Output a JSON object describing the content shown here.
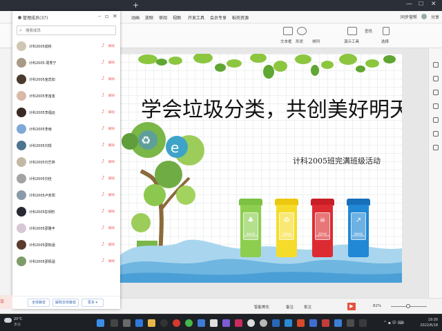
{
  "window": {
    "new_tab": "+",
    "min": "—",
    "max": "☐",
    "close": "✕"
  },
  "menubar": {
    "items": [
      "动画",
      "放映",
      "审阅",
      "视图",
      "开发工具",
      "会员专享",
      "稻壳资源"
    ],
    "share_label": "同步营帮",
    "user_label": "分享"
  },
  "ribbon": {
    "items": [
      "文本框",
      "形状",
      "排列",
      "演示工具",
      "查找",
      "选择"
    ]
  },
  "slide": {
    "title": "学会垃圾分类，共创美好明天",
    "subtitle": "计科2005班完满班级活动",
    "bins": [
      {
        "color": "#7cc142",
        "symbol": "♣",
        "label": "厨余垃圾",
        "label_en": "KITCHEN WASTE"
      },
      {
        "color": "#f2d417",
        "symbol": "♻",
        "label": "可回收物",
        "label_en": "RECYCLABLE"
      },
      {
        "color": "#d9232a",
        "symbol": "☠",
        "label": "有害垃圾",
        "label_en": "HARMFUL WASTE"
      },
      {
        "color": "#1c7fd0",
        "symbol": "↗",
        "label": "其他垃圾",
        "label_en": "OTHER WASTE"
      }
    ]
  },
  "statusbar": {
    "notes": "备注",
    "comments": "批注",
    "beautify": "智能美化",
    "zoom": "82%"
  },
  "member_panel": {
    "title": "管理成员(37)",
    "search_placeholder": "搜索成员",
    "members": [
      {
        "name": "计科2005成彬",
        "action": "解除"
      },
      {
        "name": "计科2005-周秀宁",
        "action": "解除"
      },
      {
        "name": "计科2005金蕊如",
        "action": "解除"
      },
      {
        "name": "计科2005李宙宙",
        "action": "解除"
      },
      {
        "name": "计科2005李福远",
        "action": "解除"
      },
      {
        "name": "计科2005李雨",
        "action": "解除"
      },
      {
        "name": "计科2005刘璟",
        "action": "解除"
      },
      {
        "name": "计科2005刘艺婷",
        "action": "解除"
      },
      {
        "name": "计科2005刘佳",
        "action": "解除"
      },
      {
        "name": "计科2005卢俞阳",
        "action": "解除"
      },
      {
        "name": "计科2005彭玥形",
        "action": "解除"
      },
      {
        "name": "计科2005邵雅丰",
        "action": "解除"
      },
      {
        "name": "计科2005邵知涵",
        "action": "解除"
      },
      {
        "name": "计科2005邵佩涵",
        "action": "解除"
      }
    ],
    "footer": {
      "mute_all": "全体静音",
      "unmute_all": "解除全体静音",
      "more": "更多 ▾"
    },
    "left_edge_text": "议"
  },
  "taskbar": {
    "temp": "20°C",
    "weather": "多云",
    "time": "19:30",
    "date": "2022/6/18"
  },
  "colors": {
    "accent": "#c0392b",
    "link_blue": "#3c6bb5",
    "muted_red": "#e55555"
  }
}
